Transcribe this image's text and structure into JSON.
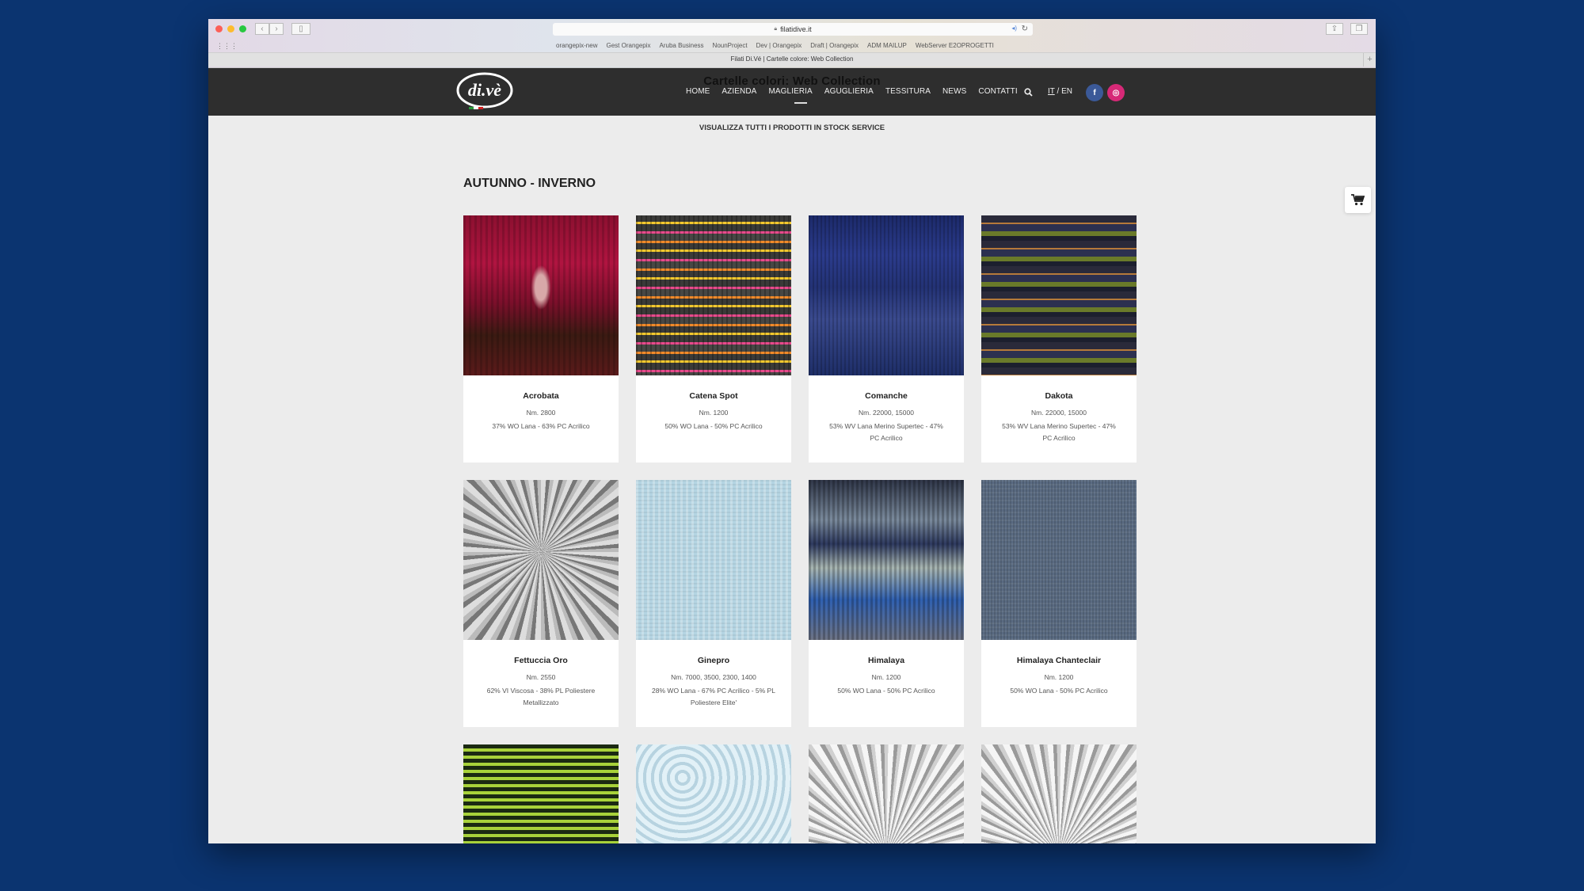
{
  "browser": {
    "url": "filatidive.it",
    "tab_title": "Filati Di.Vé | Cartelle colore: Web Collection",
    "bookmarks": [
      "orangepix-new",
      "Gest Orangepix",
      "Aruba Business",
      "NounProject",
      "Dev | Orangepix",
      "Draft | Orangepix",
      "ADM MAILUP",
      "WebServer E2OPROGETTI"
    ],
    "new_tab_label": "+"
  },
  "site": {
    "logo_text": "di.vè",
    "overlay_title": "Cartelle colori: Web Collection",
    "nav": [
      "HOME",
      "AZIENDA",
      "MAGLIERIA",
      "AGUGLIERIA",
      "TESSITURA",
      "NEWS",
      "CONTATTI"
    ],
    "active_nav": "MAGLIERIA",
    "lang_it": "IT",
    "lang_sep": " / ",
    "lang_en": "EN",
    "facebook_label": "f",
    "instagram_label": "◎",
    "stock_link": "VISUALIZZA TUTTI I PRODOTTI IN STOCK SERVICE",
    "section_title": "AUTUNNO - INVERNO"
  },
  "products": [
    {
      "name": "Acrobata",
      "nm": "Nm. 2800",
      "composition": "37% WO Lana - 63% PC Acrilico"
    },
    {
      "name": "Catena Spot",
      "nm": "Nm. 1200",
      "composition": "50% WO Lana - 50% PC Acrilico"
    },
    {
      "name": "Comanche",
      "nm": "Nm. 22000, 15000",
      "composition": "53% WV Lana Merino Supertec - 47% PC Acrilico"
    },
    {
      "name": "Dakota",
      "nm": "Nm. 22000, 15000",
      "composition": "53% WV Lana Merino Supertec - 47% PC Acrilico"
    },
    {
      "name": "Fettuccia Oro",
      "nm": "Nm. 2550",
      "composition": "62% VI Viscosa - 38% PL Poliestere Metallizzato"
    },
    {
      "name": "Ginepro",
      "nm": "Nm. 7000, 3500, 2300, 1400",
      "composition": "28% WO Lana - 67% PC Acrilico - 5% PL Poliestere Elite'"
    },
    {
      "name": "Himalaya",
      "nm": "Nm. 1200",
      "composition": "50% WO Lana - 50% PC Acrilico"
    },
    {
      "name": "Himalaya Chanteclair",
      "nm": "Nm. 1200",
      "composition": "50% WO Lana - 50% PC Acrilico"
    }
  ],
  "colors": {
    "page_bg": "#0b3470",
    "header_bg": "#2e2e2e",
    "facebook": "#3b5998",
    "instagram": "#d62977"
  }
}
